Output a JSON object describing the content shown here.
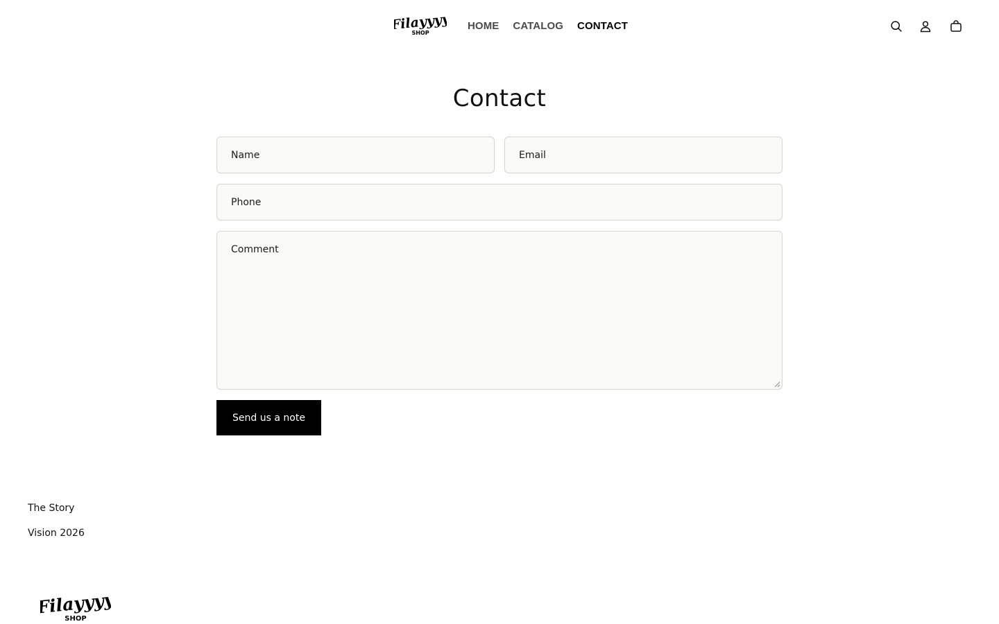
{
  "header": {
    "logo": {
      "script_text": "Filayyyy",
      "sub_text": "SHOP"
    },
    "nav": [
      {
        "label": "HOME",
        "active": false
      },
      {
        "label": "CATALOG",
        "active": false
      },
      {
        "label": "CONTACT",
        "active": true
      }
    ],
    "icons": [
      "search-icon",
      "account-icon",
      "cart-icon"
    ]
  },
  "main": {
    "title": "Contact",
    "form": {
      "name_label": "Name",
      "email_label": "Email",
      "phone_label": "Phone",
      "comment_label": "Comment",
      "submit_label": "Send us a note"
    }
  },
  "footer": {
    "links": [
      "The Story",
      "Vision 2026"
    ],
    "logo": {
      "script_text": "Filayyyy",
      "sub_text": "SHOP"
    }
  },
  "colors": {
    "button_bg": "#000000",
    "field_bg": "#fafaf9",
    "field_border": "#d6d6d0",
    "nav_inactive": "#4a4a4a"
  }
}
